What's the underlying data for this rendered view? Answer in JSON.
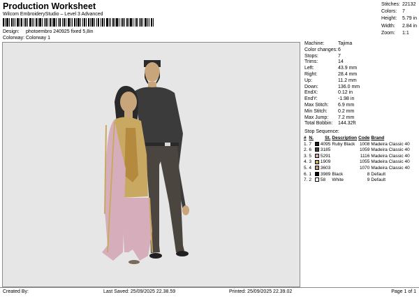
{
  "header": {
    "title": "Production Worksheet",
    "subtitle": "Wilcom EmbroideryStudio – Level 3 Advanced",
    "design_label": "Design:",
    "design_value": "photoembro 240925 fixed 5,8in",
    "colorway_label": "Colorway:",
    "colorway_value": "Colorway 1"
  },
  "stats": [
    {
      "label": "Stitches:",
      "value": "22132"
    },
    {
      "label": "Colors:",
      "value": "7"
    },
    {
      "label": "Height:",
      "value": "5.79 in"
    },
    {
      "label": "Width:",
      "value": "2.84 in"
    },
    {
      "label": "Zoom:",
      "value": "1:1"
    }
  ],
  "properties": [
    {
      "label": "Machine:",
      "value": "Tajima"
    },
    {
      "label": "Color changes:",
      "value": "6"
    },
    {
      "label": "Stops:",
      "value": "7"
    },
    {
      "label": "Trims:",
      "value": "14"
    },
    {
      "label": "Left:",
      "value": "43.9 mm"
    },
    {
      "label": "Right:",
      "value": "28.4 mm"
    },
    {
      "label": "Up:",
      "value": "11.2 mm"
    },
    {
      "label": "Down:",
      "value": "136.0 mm"
    },
    {
      "label": "EndX:",
      "value": "0.12 in"
    },
    {
      "label": "EndY:",
      "value": "-1.98 in"
    },
    {
      "label": "Max Stitch:",
      "value": "6.9 mm"
    },
    {
      "label": "Min Stitch:",
      "value": "0.2 mm"
    },
    {
      "label": "Max Jump:",
      "value": "7.2 mm"
    },
    {
      "label": "Total Bobbin:",
      "value": "144.32ft"
    }
  ],
  "sequence": {
    "title": "Stop Sequence:",
    "headers": {
      "num": "#",
      "n": "N.",
      "st": "St.",
      "description": "Description",
      "code": "Code",
      "brand": "Brand"
    },
    "rows": [
      {
        "num": "1.",
        "n": "7",
        "color": "#1b1b1b",
        "st": "4095",
        "description": "Ruby Black",
        "code": "1008",
        "brand": "Madeira Classic 40"
      },
      {
        "num": "2.",
        "n": "6",
        "color": "#3f3f3f",
        "st": "3185",
        "description": "",
        "code": "1059",
        "brand": "Madeira Classic 40"
      },
      {
        "num": "3.",
        "n": "5",
        "color": "#d8a7b6",
        "st": "5291",
        "description": "",
        "code": "1116",
        "brand": "Madeira Classic 40"
      },
      {
        "num": "4.",
        "n": "3",
        "color": "#c9a961",
        "st": "1909",
        "description": "",
        "code": "1055",
        "brand": "Madeira Classic 40"
      },
      {
        "num": "5.",
        "n": "4",
        "color": "#c39a72",
        "st": "3603",
        "description": "",
        "code": "1070",
        "brand": "Madeira Classic 40"
      },
      {
        "num": "6.",
        "n": "1",
        "color": "#000000",
        "st": "3989",
        "description": "Black",
        "code": "8",
        "brand": "Default"
      },
      {
        "num": "7.",
        "n": "2",
        "color": "#ffffff",
        "st": "58",
        "description": "White",
        "code": "9",
        "brand": "Default"
      }
    ]
  },
  "footer": {
    "created_by": "Created By:",
    "last_saved": "Last Saved: 25/09/2025 22.38.59",
    "printed": "Printed: 25/09/2025 22.39.02",
    "page": "Page 1 of 1"
  }
}
